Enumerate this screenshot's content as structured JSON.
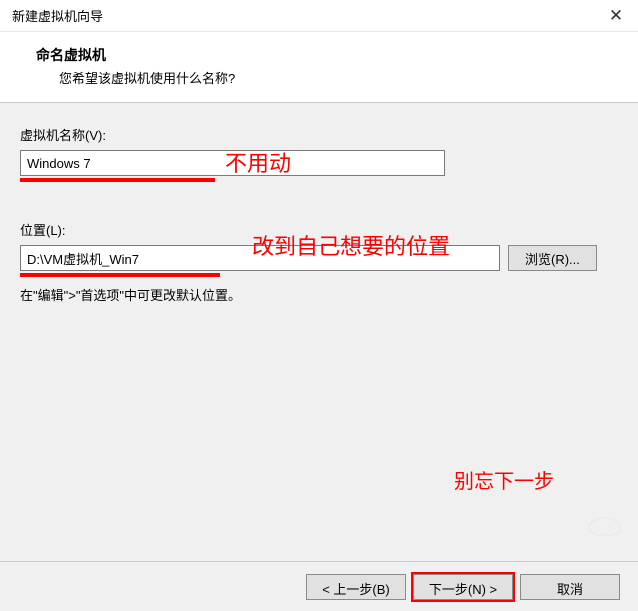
{
  "titlebar": {
    "title": "新建虚拟机向导"
  },
  "header": {
    "title": "命名虚拟机",
    "subtitle": "您希望该虚拟机使用什么名称?"
  },
  "fields": {
    "name_label": "虚拟机名称(V):",
    "name_value": "Windows 7",
    "location_label": "位置(L):",
    "location_value": "D:\\VM虚拟机_Win7",
    "browse_label": "浏览(R)..."
  },
  "hint": "在\"编辑\">\"首选项\"中可更改默认位置。",
  "annotations": {
    "anno1": "不用动",
    "anno2": "改到自己想要的位置",
    "anno3": "别忘下一步"
  },
  "footer": {
    "back": "< 上一步(B)",
    "next": "下一步(N) >",
    "cancel": "取消"
  },
  "colors": {
    "accent_red": "#ff0000"
  }
}
